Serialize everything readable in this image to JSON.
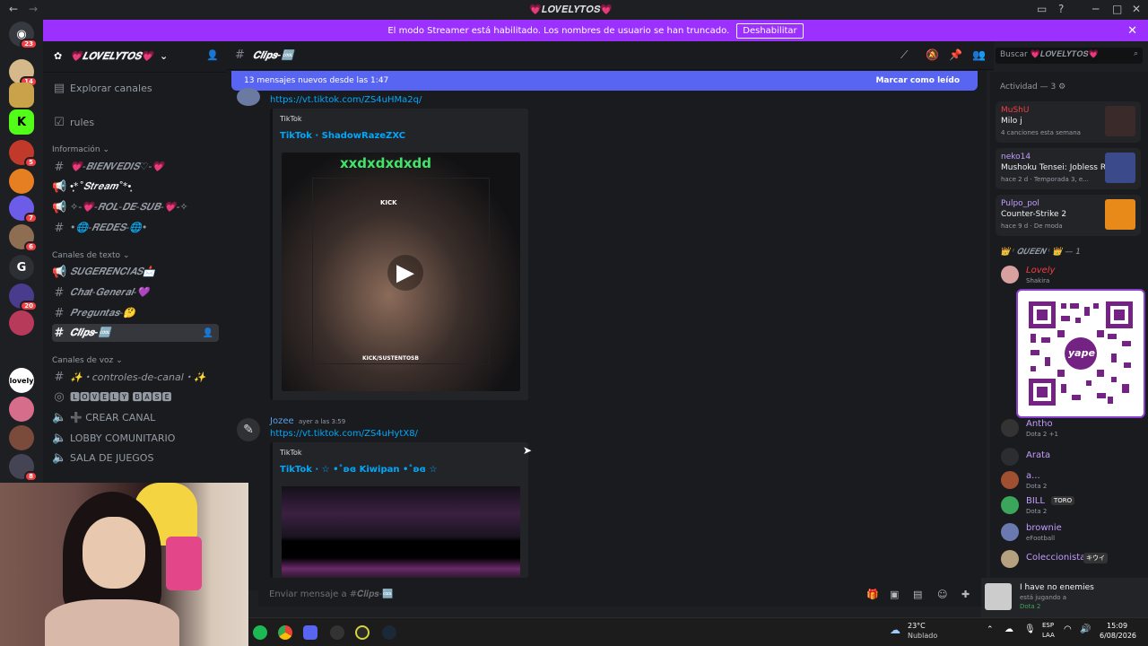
{
  "window": {
    "title": "💗𝑳𝑶𝑽𝑬𝑳𝒀𝑻𝑶𝑺💗"
  },
  "banner": {
    "text": "El modo Streamer está habilitado. Los nombres de usuario se han truncado.",
    "button": "Deshabilitar"
  },
  "rail": {
    "badges": [
      "23",
      "14",
      "5",
      "7",
      "6",
      "20",
      "5",
      "8"
    ]
  },
  "guild": {
    "name": "💗𝑳𝑶𝑽𝑬𝑳𝒀𝑻𝑶𝑺💗"
  },
  "sidebar": {
    "explore": "Explorar canales",
    "rules": "rules",
    "cat_info": "Información",
    "info_channels": [
      "💗-𝑩𝑰𝑬𝑵𝑽𝑬𝑫𝑰𝑺♡-💗",
      "•̩̩͙*˚𝑺𝒕𝒓𝒆𝒂𝒎˚*•̩̩͙",
      "✧-💗-𝑹𝑶𝑳-𝑫𝑬-𝑺𝑼𝑩-💗-✧",
      "•🌐-𝑹𝑬𝑫𝑬𝑺-🌐•"
    ],
    "cat_text": "Canales de texto",
    "text_channels": [
      "𝑺𝑼𝑮𝑬𝑹𝑬𝑵𝑪𝑰𝑨𝑺📩",
      "𝑪𝒉𝒂𝒕-𝑮𝒆𝒏𝒆𝒓𝒂𝒍-💜",
      "𝑷𝒓𝒆𝒈𝒖𝒏𝒕𝒂𝒔-🤔",
      "𝑪𝒍𝒊𝒑𝒔-🆒"
    ],
    "cat_voice": "Canales de voz",
    "voice_channels": [
      "✨・controles-de-canal・✨",
      "🅻🅾🆅🅴🅻🆈 🅱🅰🆂🅴",
      "➕ CREAR CANAL",
      "LOBBY COMUNITARIO",
      "SALA DE JUEGOS"
    ]
  },
  "header": {
    "channel": "𝑪𝒍𝒊𝒑𝒔-🆒",
    "search_placeholder": "Buscar 💗𝑳𝑶𝑽𝑬𝑳𝒀𝑻𝑶𝑺💗"
  },
  "newbar": {
    "text": "13 mensajes nuevos desde las 1:47",
    "action": "Marcar como leído"
  },
  "messages": [
    {
      "link": "https://vt.tiktok.com/ZS4uHMa2q/",
      "provider": "TikTok",
      "embed_title": "TikTok · ShadowRazeZXC",
      "video_caption": "xxdxdxdxdd",
      "overlay_top": "KICK",
      "overlay_bottom": "KICK/SUSTENTOSB"
    },
    {
      "author": "Jozee",
      "time": "ayer a las 3:59",
      "link": "https://vt.tiktok.com/ZS4uHytX8/",
      "provider": "TikTok",
      "embed_title": "TikTok · ☆ •˚ʚɞ Kiwipan •˚ʚɞ ☆"
    }
  ],
  "composer": {
    "placeholder": "Enviar mensaje a #𝑪𝒍𝒊𝒑𝒔-🆒"
  },
  "activity": {
    "header": "Actividad — 3",
    "items": [
      {
        "name": "MuShU",
        "title": "Milo j",
        "sub": "4 canciones esta semana"
      },
      {
        "name": "neko14",
        "title": "Mushoku Tensei: Jobless R...",
        "sub": "hace 2 d · Temporada 3, e..."
      },
      {
        "name": "Pulpo_pol",
        "title": "Counter-Strike 2",
        "sub": "hace 9 d · De moda"
      }
    ]
  },
  "members": {
    "role_header": "👑 ᵎ 𝑸𝑼𝑬𝑬𝑵 ᵎ 👑 — 1",
    "list": [
      {
        "name": "Lovely",
        "sub": "Shakira"
      },
      {
        "name": "Antho",
        "sub": "Dota 2 +1"
      },
      {
        "name": "Arata",
        "sub": ""
      },
      {
        "name": "a...",
        "sub": "Dota 2"
      },
      {
        "name": "BILL",
        "sub": "Dota 2",
        "tag": "TORO"
      },
      {
        "name": "brownie",
        "sub": "eFootball"
      },
      {
        "name": "Coleccionista",
        "sub": "",
        "tag": "キウイ"
      }
    ]
  },
  "nowplaying": {
    "title": "I have no enemies",
    "sub": "está jugando a",
    "game": "Dota 2"
  },
  "taskbar": {
    "temp": "23°C",
    "weather": "Nublado",
    "lang1": "ESP",
    "lang2": "LAA",
    "time": "15:09",
    "date": "6/08/2026"
  },
  "qr": {
    "label": "yape"
  }
}
